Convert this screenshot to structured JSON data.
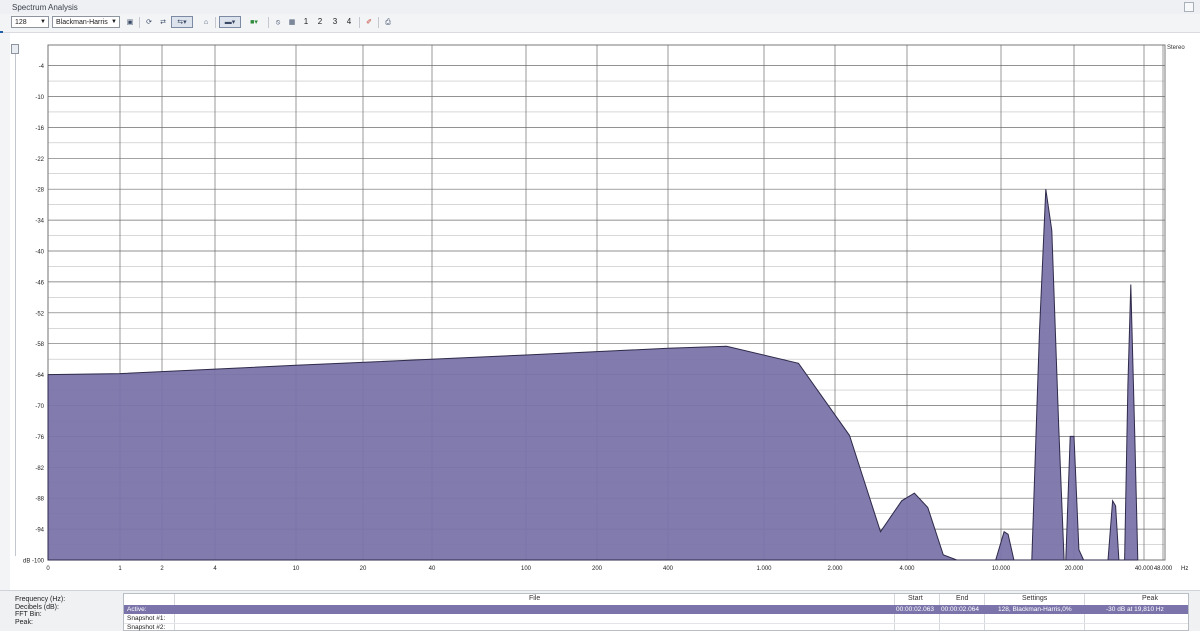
{
  "window": {
    "title": "Spectrum Analysis"
  },
  "toolbar": {
    "fft_size": "128",
    "window_function": "Blackman-Harris",
    "snapshot_numbers": [
      "1",
      "2",
      "3",
      "4"
    ]
  },
  "chart_data": {
    "type": "area",
    "title": "",
    "channel_label": "Stereo",
    "fill_color": "#7a74aa",
    "grid": true,
    "x_scale": "log",
    "x_tick_values": [
      0,
      1,
      2,
      4,
      10,
      20,
      40,
      100,
      200,
      400,
      1000,
      2000,
      4000,
      10000,
      20000,
      40000,
      48000
    ],
    "x_tick_labels": [
      "0",
      "1",
      "2",
      "4",
      "10",
      "20",
      "40",
      "100",
      "200",
      "400",
      "1.000",
      "2.000",
      "4.000",
      "10.000",
      "20.000",
      "40.000",
      "48.000"
    ],
    "x_unit": "Hz",
    "y_unit": "dB",
    "ylim": [
      -100,
      0
    ],
    "y_tick_values": [
      -4,
      -10,
      -16,
      -22,
      -28,
      -34,
      -40,
      -46,
      -52,
      -58,
      -64,
      -70,
      -76,
      -82,
      -88,
      -94,
      -100
    ],
    "y_tick_labels": [
      "-4",
      "-10",
      "-16",
      "-22",
      "-28",
      "-34",
      "-40",
      "-46",
      "-52",
      "-58",
      "-64",
      "-70",
      "-76",
      "-82",
      "-88",
      "-94",
      "dB -100"
    ],
    "series": [
      {
        "values": [
          [
            0,
            -64
          ],
          [
            1,
            -63.8
          ],
          [
            10,
            -62.2
          ],
          [
            100,
            -60.2
          ],
          [
            400,
            -58.9
          ],
          [
            700,
            -58.5
          ],
          [
            1400,
            -61.8
          ],
          [
            2300,
            -75.8
          ],
          [
            3100,
            -94.5
          ],
          [
            3800,
            -88.5
          ],
          [
            4300,
            -87
          ],
          [
            4900,
            -89.8
          ],
          [
            5700,
            -99
          ],
          [
            6500,
            -100
          ],
          [
            9500,
            -100
          ],
          [
            10300,
            -94.5
          ],
          [
            10700,
            -95
          ],
          [
            11300,
            -100
          ],
          [
            13400,
            -100
          ],
          [
            14400,
            -56
          ],
          [
            15300,
            -28
          ],
          [
            16200,
            -36
          ],
          [
            17300,
            -74
          ],
          [
            18200,
            -100
          ],
          [
            18500,
            -100
          ],
          [
            19300,
            -76
          ],
          [
            20000,
            -76
          ],
          [
            21000,
            -98
          ],
          [
            22000,
            -100
          ],
          [
            28000,
            -100
          ],
          [
            29300,
            -88.5
          ],
          [
            30200,
            -89.5
          ],
          [
            31200,
            -100
          ],
          [
            33000,
            -100
          ],
          [
            34100,
            -66
          ],
          [
            35100,
            -46.5
          ],
          [
            36500,
            -76
          ],
          [
            37600,
            -100
          ]
        ]
      }
    ]
  },
  "bottom_panel": {
    "labels": [
      "Frequency (Hz):",
      "Decibels (dB):",
      "FFT Bin:",
      "Peak:"
    ],
    "columns": [
      "File",
      "Start",
      "End",
      "Settings",
      "Peak"
    ],
    "rows": [
      {
        "name": "Active:",
        "start": "00:00:02.063",
        "end": "00:00:02.064",
        "settings": "128, Blackman-Harris,0%",
        "peak": "-30 dB at 19,810 Hz"
      },
      {
        "name": "Snapshot #1:"
      },
      {
        "name": "Snapshot #2:"
      }
    ]
  }
}
